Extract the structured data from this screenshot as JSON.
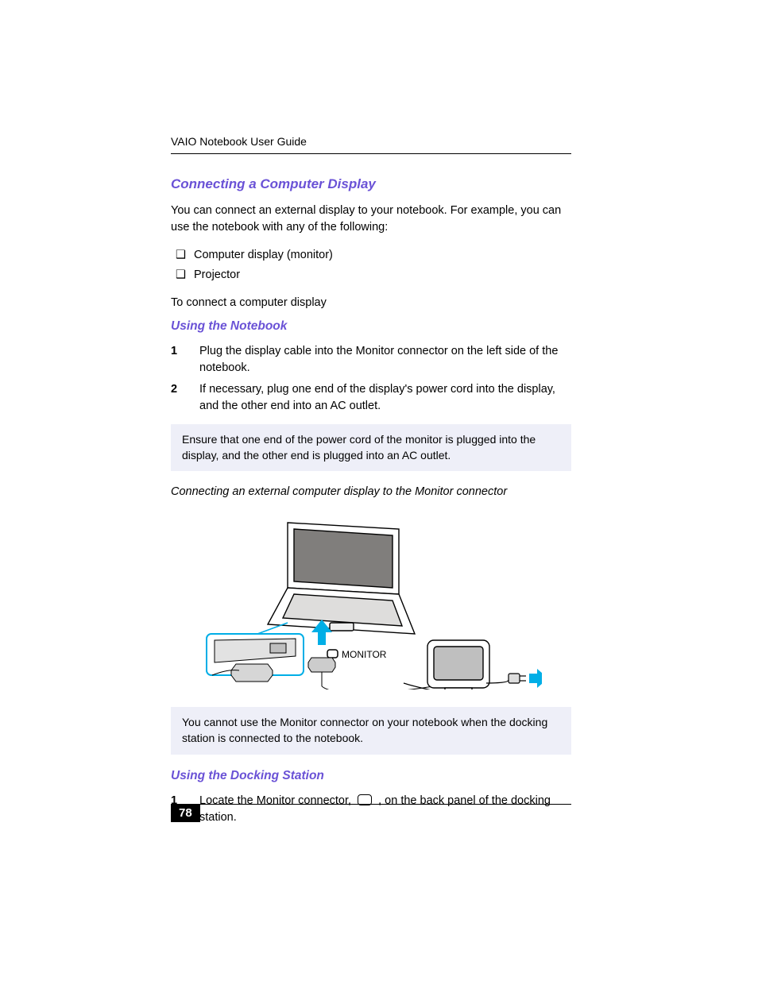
{
  "page": {
    "running_header": "VAIO Notebook User Guide",
    "number": "78"
  },
  "section1": {
    "title": "Connecting a Computer Display",
    "intro": "You can connect an external display to your notebook. For example, you can use the notebook with any of the following:",
    "bullets": [
      "Computer display (monitor)",
      "Projector"
    ],
    "toconnect": "To connect a computer display"
  },
  "notebook": {
    "heading": "Using the Notebook",
    "steps": [
      "Plug the display cable into the Monitor connector on the left side of the notebook.",
      "If necessary, plug one end of the display's power cord into the display, and the other end into an AC outlet."
    ],
    "note": "Ensure that one end of the power cord of the monitor is plugged into the display, and the other end is plugged into an AC outlet."
  },
  "figure": {
    "caption": "Connecting an external computer display to the Monitor connector",
    "label_monitor": "MONITOR"
  },
  "dock_note": "You cannot use the Monitor connector on your notebook when the docking station is connected to the notebook.",
  "docking": {
    "heading": "Using the Docking Station",
    "step1_parts": [
      "Locate the Monitor connector,",
      ", on the back panel of the docking station."
    ]
  }
}
